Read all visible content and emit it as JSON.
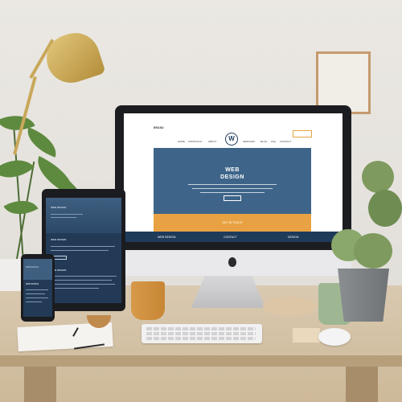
{
  "website": {
    "brand": "BRAND",
    "nav_left": [
      "HOME",
      "PORTFOLIO",
      "ABOUT"
    ],
    "logo_letter": "W",
    "nav_right": [
      "SERVICES",
      "BLOG",
      "FAQ",
      "CONTACT"
    ],
    "hero_title_line1": "WEB",
    "hero_title_line2": "DESIGN",
    "cta_label": "GET IN TOUCH",
    "footer_items": [
      "WEB DESIGN",
      "CONTACT",
      "DESIGN"
    ]
  },
  "tablet": {
    "hero_label": "WEB DESIGN",
    "heading": "WEB DESIGN",
    "subheading": "WEB DESIGN"
  },
  "phone": {
    "label": "WEB DESIGN",
    "heading": "WEB DESIGN"
  },
  "colors": {
    "navy": "#1f3b5a",
    "hero_blue": "#3e6589",
    "accent_orange": "#e9a243",
    "wall": "#e6e3de",
    "desk": "#d4c2a5"
  }
}
